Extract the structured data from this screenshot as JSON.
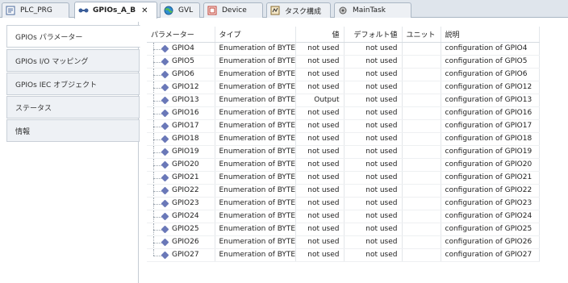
{
  "tabs": [
    {
      "label": "PLC_PRG",
      "icon": "program-icon",
      "active": false
    },
    {
      "label": "GPIOs_A_B",
      "icon": "device-io-icon",
      "active": true,
      "close": "✕"
    },
    {
      "label": "GVL",
      "icon": "globe-icon",
      "active": false
    },
    {
      "label": "Device",
      "icon": "device-icon",
      "active": false
    },
    {
      "label": "タスク構成",
      "icon": "task-config-icon",
      "active": false
    },
    {
      "label": "MainTask",
      "icon": "gear-task-icon",
      "active": false
    }
  ],
  "side_tabs": [
    {
      "label": "GPIOs パラメーター",
      "active": true
    },
    {
      "label": "GPIOs I/O マッピング",
      "active": false
    },
    {
      "label": "GPIOs IEC オブジェクト",
      "active": false
    },
    {
      "label": "ステータス",
      "active": false
    },
    {
      "label": "情報",
      "active": false
    }
  ],
  "table": {
    "headers": [
      "パラメーター",
      "タイプ",
      "値",
      "デフォルト値",
      "ユニット",
      "説明"
    ],
    "rows": [
      {
        "name": "GPIO4",
        "type": "Enumeration of BYTE",
        "value": "not used",
        "default": "not used",
        "unit": "",
        "desc": "configuration of GPIO4"
      },
      {
        "name": "GPIO5",
        "type": "Enumeration of BYTE",
        "value": "not used",
        "default": "not used",
        "unit": "",
        "desc": "configuration of GPIO5"
      },
      {
        "name": "GPIO6",
        "type": "Enumeration of BYTE",
        "value": "not used",
        "default": "not used",
        "unit": "",
        "desc": "configuration of GPIO6"
      },
      {
        "name": "GPIO12",
        "type": "Enumeration of BYTE",
        "value": "not used",
        "default": "not used",
        "unit": "",
        "desc": "configuration of GPIO12"
      },
      {
        "name": "GPIO13",
        "type": "Enumeration of BYTE",
        "value": "Output",
        "default": "not used",
        "unit": "",
        "desc": "configuration of GPIO13"
      },
      {
        "name": "GPIO16",
        "type": "Enumeration of BYTE",
        "value": "not used",
        "default": "not used",
        "unit": "",
        "desc": "configuration of GPIO16"
      },
      {
        "name": "GPIO17",
        "type": "Enumeration of BYTE",
        "value": "not used",
        "default": "not used",
        "unit": "",
        "desc": "configuration of GPIO17"
      },
      {
        "name": "GPIO18",
        "type": "Enumeration of BYTE",
        "value": "not used",
        "default": "not used",
        "unit": "",
        "desc": "configuration of GPIO18"
      },
      {
        "name": "GPIO19",
        "type": "Enumeration of BYTE",
        "value": "not used",
        "default": "not used",
        "unit": "",
        "desc": "configuration of GPIO19"
      },
      {
        "name": "GPIO20",
        "type": "Enumeration of BYTE",
        "value": "not used",
        "default": "not used",
        "unit": "",
        "desc": "configuration of GPIO20"
      },
      {
        "name": "GPIO21",
        "type": "Enumeration of BYTE",
        "value": "not used",
        "default": "not used",
        "unit": "",
        "desc": "configuration of GPIO21"
      },
      {
        "name": "GPIO22",
        "type": "Enumeration of BYTE",
        "value": "not used",
        "default": "not used",
        "unit": "",
        "desc": "configuration of GPIO22"
      },
      {
        "name": "GPIO23",
        "type": "Enumeration of BYTE",
        "value": "not used",
        "default": "not used",
        "unit": "",
        "desc": "configuration of GPIO23"
      },
      {
        "name": "GPIO24",
        "type": "Enumeration of BYTE",
        "value": "not used",
        "default": "not used",
        "unit": "",
        "desc": "configuration of GPIO24"
      },
      {
        "name": "GPIO25",
        "type": "Enumeration of BYTE",
        "value": "not used",
        "default": "not used",
        "unit": "",
        "desc": "configuration of GPIO25"
      },
      {
        "name": "GPIO26",
        "type": "Enumeration of BYTE",
        "value": "not used",
        "default": "not used",
        "unit": "",
        "desc": "configuration of GPIO26"
      },
      {
        "name": "GPIO27",
        "type": "Enumeration of BYTE",
        "value": "not used",
        "default": "not used",
        "unit": "",
        "desc": "configuration of GPIO27"
      }
    ]
  },
  "colors": {
    "accent": "#5b86b8",
    "tab_bg": "#dfe5ec",
    "param_icon": "#6a78b8"
  }
}
